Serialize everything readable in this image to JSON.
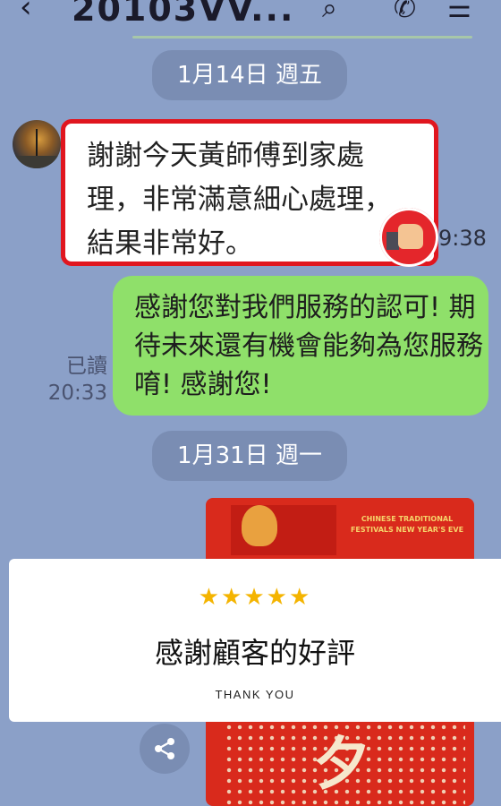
{
  "header": {
    "title": "20103VV...",
    "back_icon": "‹",
    "search_icon": "search-icon",
    "phone_icon": "phone-icon",
    "menu_icon": "menu-icon"
  },
  "date_pills": [
    "1月14日 週五",
    "1月31日 週一"
  ],
  "incoming_message": {
    "text": "謝謝今天黃師傅到家處理，非常滿意細心處理，結果非常好。",
    "time": "9:38"
  },
  "outgoing_message": {
    "text": "感謝您對我們服務的認可! 期待未來還有機會能夠為您服務唷! 感謝您!",
    "read_label": "已讀",
    "time": "20:33"
  },
  "image_card": {
    "english_text": "CHINESE TRADITIONAL FESTIVALS NEW YEAR'S EVE",
    "big_char": "夕"
  },
  "overlay": {
    "stars": "★★★★★",
    "rating": 5,
    "heading": "感謝顧客的好評",
    "subheading": "THANK YOU"
  },
  "colors": {
    "background": "#8ba0c8",
    "outgoing_bubble": "#8fe06a",
    "highlight_border": "#e0161f",
    "star": "#f4b400"
  }
}
